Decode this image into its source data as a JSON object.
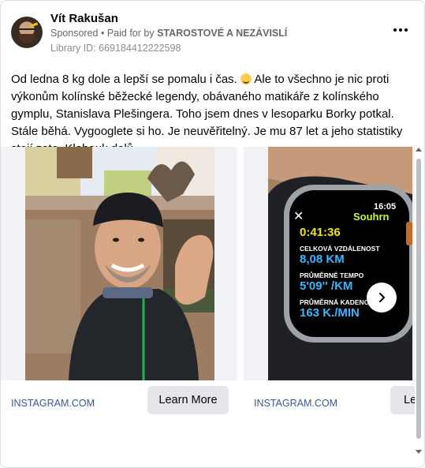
{
  "ad": {
    "advertiser_name": "Vít Rakušan",
    "sponsored_label": "Sponsored",
    "separator": "•",
    "paid_for_prefix": "Paid for by",
    "payer": "STAROSTOVÉ A NEZÁVISLÍ",
    "library_id": "Library ID: 669184412222598",
    "body_before_emoji": "Od ledna 8 kg dole a lepší se pomalu i čas.",
    "body_after_emoji": "Ale to všechno je nic proti výkonům kolínské běžecké legendy, obávaného matikáře z kolínského gympl­u, Stanislava Plešingera. Toho jsem dnes v lesoparku Borky potkal. Stále běhá. Vygooglete si ho. Je neuvěřitelný. Je mu 87 let a jeho statistiky stojí zato. Klobouk dolů."
  },
  "carousel": {
    "cards": [
      {
        "caption": "INSTAGRAM.COM",
        "cta": "Learn More"
      },
      {
        "caption": "INSTAGRAM.COM",
        "cta": "Le"
      }
    ]
  },
  "watch": {
    "time": "16:05",
    "title": "Souhrn",
    "duration": "0:41:36",
    "distance_label": "CELKOVÁ VZDÁLENOST",
    "distance": "8,08 KM",
    "pace_label": "PRŮMĚRNÉ TEMPO",
    "pace": "5'09'' /KM",
    "cadence_label": "PRŮMĚRNÁ KADENC",
    "cadence": "163 K./MIN"
  },
  "colors": {
    "link": "#385898",
    "secondary_text": "#65676b",
    "watch_green": "#c8f53a",
    "watch_blue": "#35b6ff"
  },
  "icons": {
    "more": "more-dots-icon",
    "next": "chevron-right-icon",
    "close": "close-icon"
  }
}
